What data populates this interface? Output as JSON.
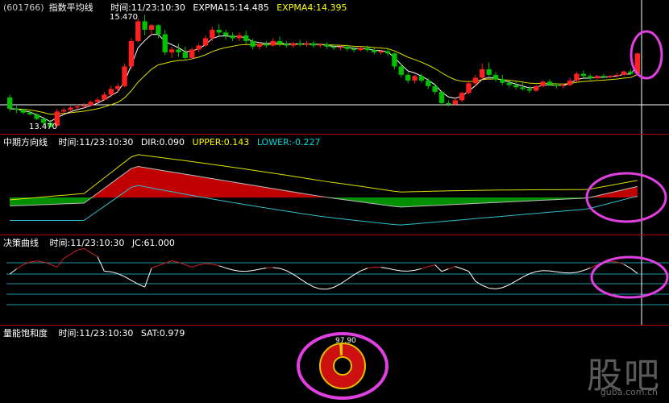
{
  "panel1": {
    "code": "(601766)",
    "title": "指数平均线",
    "time": "时间:11/23:10:30",
    "expma15": "EXPMA15:14.485",
    "expma4": "EXPMA4:14.395",
    "high_label": "15.470",
    "low_label": "13.470"
  },
  "panel2": {
    "title": "中期方向线",
    "time": "时间:11/23:10:30",
    "dir": "DIR:0.090",
    "upper": "UPPER:0.143",
    "lower": "LOWER:-0.227"
  },
  "panel3": {
    "title": "决策曲线",
    "time": "时间:11/23:10:30",
    "jc": "JC:61.000"
  },
  "panel4": {
    "title": "量能饱和度",
    "time": "时间:11/23:10:30",
    "sat": "SAT:0.979",
    "donut_label": "97.90"
  },
  "watermark": {
    "main": "股吧",
    "sub": "guba.com.cn"
  },
  "colors": {
    "up": "#ff2020",
    "down": "#00c000",
    "yellow": "#e0e000",
    "cyan": "#30c0d0",
    "white": "#ffffff",
    "highlight": "#e040e0",
    "frame": "#b40000"
  },
  "chart_data": {
    "type": "candlestick",
    "price_range": [
      13.47,
      15.47
    ],
    "candles": [
      [
        14.0,
        14.05,
        13.8,
        13.75
      ],
      [
        13.8,
        13.85,
        13.78,
        13.72
      ],
      [
        13.78,
        13.8,
        13.73,
        13.7
      ],
      [
        13.73,
        13.76,
        13.7,
        13.68
      ],
      [
        13.7,
        13.72,
        13.62,
        13.6
      ],
      [
        13.62,
        13.66,
        13.55,
        13.5
      ],
      [
        13.55,
        13.6,
        13.48,
        13.47
      ],
      [
        13.5,
        13.8,
        13.75,
        13.48
      ],
      [
        13.75,
        13.82,
        13.78,
        13.7
      ],
      [
        13.78,
        13.85,
        13.82,
        13.74
      ],
      [
        13.82,
        13.88,
        13.84,
        13.79
      ],
      [
        13.84,
        13.9,
        13.86,
        13.8
      ],
      [
        13.86,
        13.95,
        13.92,
        13.84
      ],
      [
        13.92,
        14.0,
        13.96,
        13.9
      ],
      [
        13.96,
        14.1,
        14.05,
        13.94
      ],
      [
        14.05,
        14.2,
        14.15,
        14.0
      ],
      [
        14.15,
        14.25,
        14.2,
        14.1
      ],
      [
        14.2,
        14.6,
        14.55,
        14.18
      ],
      [
        14.55,
        15.05,
        15.0,
        14.5
      ],
      [
        15.0,
        15.4,
        15.35,
        14.98
      ],
      [
        15.35,
        15.47,
        15.2,
        15.1
      ],
      [
        15.2,
        15.3,
        15.28,
        15.1
      ],
      [
        15.28,
        15.3,
        15.12,
        15.05
      ],
      [
        15.12,
        15.2,
        14.8,
        14.75
      ],
      [
        14.8,
        14.9,
        14.85,
        14.7
      ],
      [
        14.85,
        14.95,
        14.8,
        14.72
      ],
      [
        14.8,
        14.9,
        14.7,
        14.65
      ],
      [
        14.7,
        14.88,
        14.85,
        14.68
      ],
      [
        14.85,
        14.95,
        14.92,
        14.8
      ],
      [
        14.92,
        15.1,
        15.05,
        14.9
      ],
      [
        15.05,
        15.25,
        15.2,
        15.0
      ],
      [
        15.2,
        15.3,
        15.15,
        15.1
      ],
      [
        15.15,
        15.2,
        15.1,
        15.02
      ],
      [
        15.1,
        15.15,
        15.05,
        15.0
      ],
      [
        15.05,
        15.15,
        15.1,
        15.0
      ],
      [
        15.1,
        15.18,
        15.0,
        14.95
      ],
      [
        15.0,
        15.05,
        14.9,
        14.85
      ],
      [
        14.9,
        14.98,
        14.95,
        14.85
      ],
      [
        14.95,
        15.0,
        14.92,
        14.88
      ],
      [
        14.92,
        15.05,
        15.0,
        14.9
      ],
      [
        15.0,
        15.08,
        14.95,
        14.9
      ],
      [
        14.95,
        15.0,
        14.92,
        14.88
      ],
      [
        14.92,
        14.98,
        14.96,
        14.88
      ],
      [
        14.96,
        15.02,
        14.94,
        14.9
      ],
      [
        14.94,
        15.0,
        14.96,
        14.9
      ],
      [
        14.96,
        15.0,
        14.92,
        14.88
      ],
      [
        14.92,
        14.96,
        14.94,
        14.88
      ],
      [
        14.94,
        14.98,
        14.9,
        14.86
      ],
      [
        14.9,
        14.95,
        14.88,
        14.84
      ],
      [
        14.88,
        14.92,
        14.9,
        14.84
      ],
      [
        14.9,
        14.94,
        14.86,
        14.82
      ],
      [
        14.86,
        14.9,
        14.84,
        14.8
      ],
      [
        14.84,
        14.9,
        14.88,
        14.82
      ],
      [
        14.88,
        14.92,
        14.84,
        14.8
      ],
      [
        14.84,
        14.88,
        14.8,
        14.76
      ],
      [
        14.8,
        14.84,
        14.82,
        14.76
      ],
      [
        14.82,
        14.86,
        14.78,
        14.74
      ],
      [
        14.78,
        14.8,
        14.55,
        14.5
      ],
      [
        14.55,
        14.6,
        14.4,
        14.35
      ],
      [
        14.4,
        14.45,
        14.3,
        14.25
      ],
      [
        14.3,
        14.4,
        14.38,
        14.25
      ],
      [
        14.38,
        14.42,
        14.3,
        14.26
      ],
      [
        14.3,
        14.34,
        14.2,
        14.15
      ],
      [
        14.2,
        14.25,
        14.1,
        14.05
      ],
      [
        14.1,
        14.12,
        13.9,
        13.85
      ],
      [
        13.9,
        13.95,
        13.88,
        13.84
      ],
      [
        13.88,
        14.0,
        13.95,
        13.86
      ],
      [
        13.95,
        14.1,
        14.08,
        13.92
      ],
      [
        14.08,
        14.3,
        14.25,
        14.05
      ],
      [
        14.25,
        14.4,
        14.35,
        14.2
      ],
      [
        14.35,
        14.6,
        14.5,
        14.3
      ],
      [
        14.5,
        14.62,
        14.4,
        14.38
      ],
      [
        14.4,
        14.45,
        14.32,
        14.28
      ],
      [
        14.32,
        14.4,
        14.26,
        14.22
      ],
      [
        14.26,
        14.3,
        14.22,
        14.18
      ],
      [
        14.22,
        14.28,
        14.18,
        14.14
      ],
      [
        14.18,
        14.26,
        14.15,
        14.12
      ],
      [
        14.15,
        14.2,
        14.12,
        14.08
      ],
      [
        14.12,
        14.22,
        14.2,
        14.1
      ],
      [
        14.2,
        14.3,
        14.28,
        14.18
      ],
      [
        14.28,
        14.32,
        14.22,
        14.2
      ],
      [
        14.22,
        14.26,
        14.2,
        14.16
      ],
      [
        14.2,
        14.25,
        14.22,
        14.16
      ],
      [
        14.22,
        14.35,
        14.3,
        14.2
      ],
      [
        14.3,
        14.45,
        14.42,
        14.28
      ],
      [
        14.42,
        14.48,
        14.38,
        14.34
      ],
      [
        14.38,
        14.42,
        14.34,
        14.3
      ],
      [
        14.34,
        14.4,
        14.38,
        14.32
      ],
      [
        14.38,
        14.42,
        14.36,
        14.34
      ],
      [
        14.36,
        14.4,
        14.38,
        14.34
      ],
      [
        14.38,
        14.44,
        14.4,
        14.36
      ],
      [
        14.4,
        14.48,
        14.46,
        14.38
      ],
      [
        14.46,
        14.5,
        14.42,
        14.4
      ],
      [
        14.42,
        14.8,
        14.78,
        14.4
      ]
    ]
  }
}
